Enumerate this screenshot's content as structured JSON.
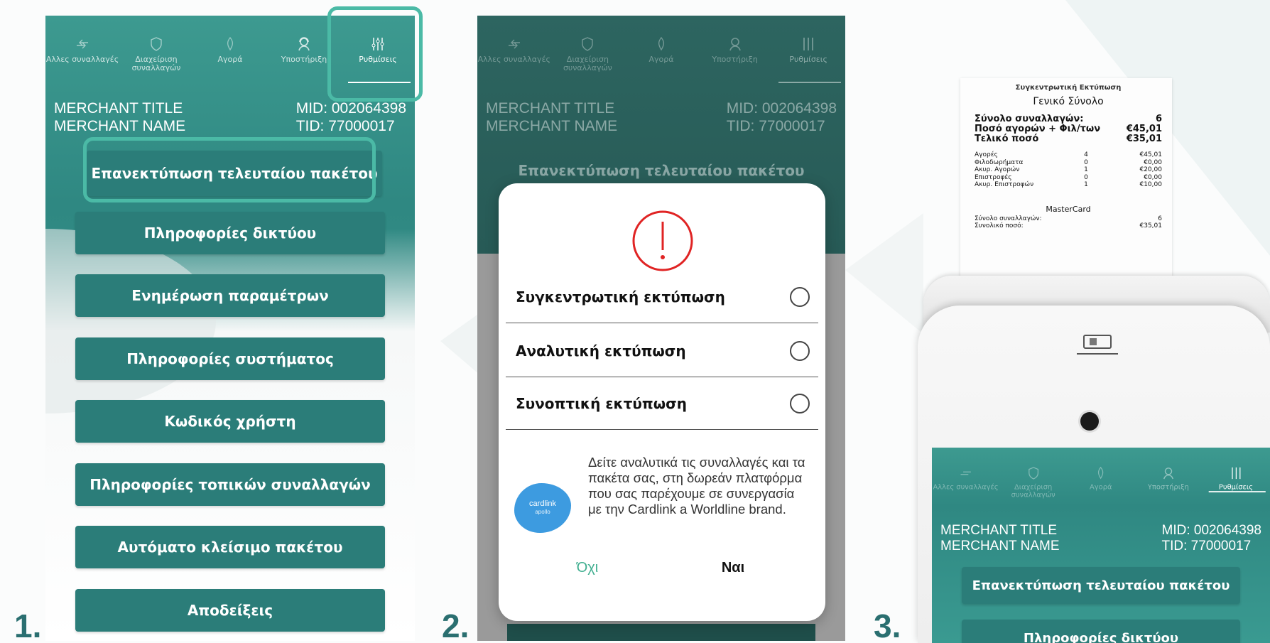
{
  "steps": [
    "1.",
    "2.",
    "3."
  ],
  "tabs": [
    {
      "label": "Αλλες συναλλαγές",
      "icon": "transfer-icon"
    },
    {
      "label": "Διαχείριση συναλλαγών",
      "icon": "manage-icon"
    },
    {
      "label": "Αγορά",
      "icon": "purchase-icon"
    },
    {
      "label": "Υποστήριξη",
      "icon": "support-agent-icon"
    },
    {
      "label": "Ρυθμίσεις",
      "icon": "settings-sliders-icon"
    }
  ],
  "merchant": {
    "title": "MERCHANT TITLE",
    "name": "MERCHANT NAME",
    "mid": "MID: 002064398",
    "tid": "TID: 77000017"
  },
  "menu": [
    "Επανεκτύπωση τελευταίου πακέτου",
    "Πληροφορίες δικτύου",
    "Ενημέρωση παραμέτρων",
    "Πληροφορίες συστήματος",
    "Κωδικός χρήστη",
    "Πληροφορίες τοπικών συναλλαγών",
    "Αυτόματο κλείσιμο πακέτου",
    "Αποδείξεις"
  ],
  "dialog": {
    "options": [
      "Συγκεντρωτική εκτύπωση",
      "Αναλυτική εκτύπωση",
      "Συνοπτική εκτύπωση"
    ],
    "promo_text": "Δείτε αναλυτικά τις συναλλαγές και τα πακέτα σας, στη δωρεάν πλατφόρμα που σας παρέχουμε σε συνεργασία με την Cardlink a Worldline brand.",
    "logo_line1": "cardlink",
    "logo_line2": "apollo",
    "no_label": "Όχι",
    "yes_label": "Ναι",
    "accent_color": "#e02424"
  },
  "receipt": {
    "header": "Συγκεντρωτική Εκτύπωση",
    "subheader": "Γενικό Σύνολο",
    "totals": [
      {
        "label": "Σύνολο συναλλαγών:",
        "value": "6"
      },
      {
        "label": "Ποσό αγορών + Φιλ/των",
        "value": "€45,01"
      },
      {
        "label": "Τελικό ποσό",
        "value": "€35,01"
      }
    ],
    "details": [
      {
        "label": "Αγορές",
        "count": "4",
        "value": "€45,01"
      },
      {
        "label": "Φιλοδωρήματα",
        "count": "0",
        "value": "€0,00"
      },
      {
        "label": "Ακυρ. Αγορών",
        "count": "1",
        "value": "€20,00"
      },
      {
        "label": "Επιστροφές",
        "count": "0",
        "value": "€0,00"
      },
      {
        "label": "Ακυρ. Επιστροφών",
        "count": "1",
        "value": "€10,00"
      }
    ],
    "card_brand": "MasterCard",
    "card_rows": [
      {
        "label": "Σύνολο συναλλαγών:",
        "value": "6"
      },
      {
        "label": "Συνολικό ποσό:",
        "value": "€35,01"
      }
    ]
  },
  "colors": {
    "teal": "#2f8882",
    "button": "#2b7d79",
    "highlight": "#4bbaa6",
    "step_number": "#2a6f70"
  }
}
